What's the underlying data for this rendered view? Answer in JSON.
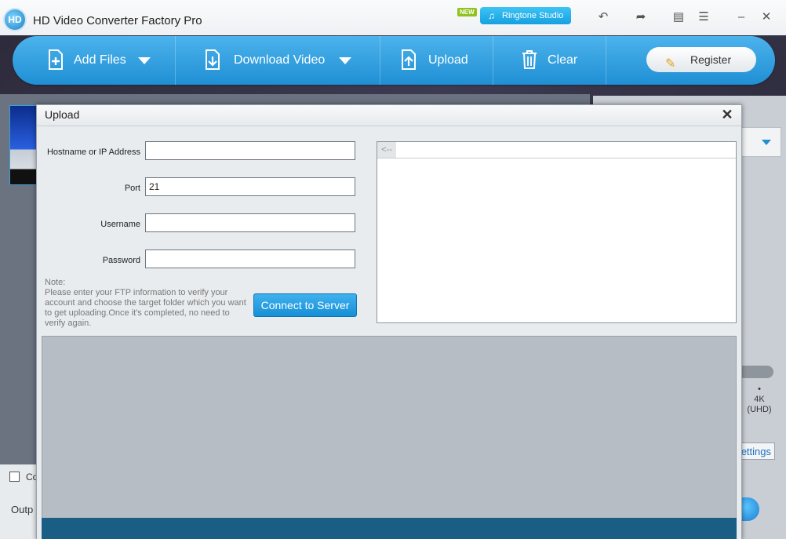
{
  "app": {
    "logo_text": "HD",
    "title": "HD Video Converter Factory Pro",
    "new_badge": "NEW",
    "ringtone_label": "Ringtone Studio"
  },
  "titlebar_icons": [
    "undo-icon",
    "update-icon",
    "chat-icon",
    "list-icon",
    "minimize-icon",
    "close-icon"
  ],
  "toolbar": {
    "add_files": "Add Files",
    "download_video": "Download Video",
    "upload": "Upload",
    "clear": "Clear",
    "register": "Register"
  },
  "background": {
    "resolution_label": "4K\n(UHD)",
    "settings_label": "ettings",
    "checkbox_label": "Co",
    "output_label": "Outp"
  },
  "dialog": {
    "title": "Upload",
    "fields": {
      "hostname_label": "Hostname or IP Address",
      "hostname_value": "",
      "port_label": "Port",
      "port_value": "21",
      "username_label": "Username",
      "username_value": "",
      "password_label": "Password",
      "password_value": ""
    },
    "note": "Note:\nPlease enter your FTP information to verify your account and choose the target folder which you want to get uploading.Once it's completed, no need to verify again.",
    "connect_label": "Connect to Server",
    "back_label": "<--"
  },
  "colors": {
    "toolbar_blue": "#1f8fd4",
    "connect_blue": "#168fd6",
    "footer_bar": "#1a5e86"
  }
}
